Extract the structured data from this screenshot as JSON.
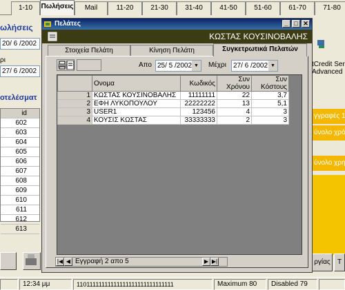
{
  "top_tabs": [
    "1-10",
    "Πωλήσεις",
    "Mail",
    "11-20",
    "21-30",
    "31-40",
    "41-50",
    "51-60",
    "61-70",
    "71-80"
  ],
  "left": {
    "heading": "ωλήσεις",
    "date_from": "20/ 6 /2002",
    "label_to": "ρι",
    "date_to": "27/ 6 /2002",
    "results_heading": "οτελέσματ",
    "id_header": "id",
    "ids": [
      "602",
      "603",
      "604",
      "605",
      "606",
      "607",
      "608",
      "609",
      "610",
      "611",
      "612",
      "613"
    ]
  },
  "right": {
    "server_line1": "tCredit Serve",
    "server_line2": "Advanced",
    "bar1": "γγραφές 1",
    "bar2": "ύνολο χρό",
    "bar3": "ύνολο χρη",
    "button1": "ργίας",
    "button2": "T"
  },
  "dialog": {
    "title": "Πελάτες",
    "customer_name": "ΚΩΣΤΑΣ ΚΟΥΣΙΝΟΒΑΛΗΣ",
    "tabs": [
      "Στοιχεία Πελάτη",
      "Κίνηση Πελάτη",
      "Συγκετρωτικά Πελατών"
    ],
    "from_label": "Απο",
    "from_date": "25/ 5 /2002",
    "to_label": "Μέχρι",
    "to_date": "27/ 6 /2002",
    "columns": [
      "",
      "Ονομα",
      "Κωδικός",
      "Συν Χρόνου",
      "Συν Κόστους"
    ],
    "rows": [
      [
        "1",
        "ΚΩΣΤΑΣ ΚΟΥΣΙΝΟΒΑΛΗΣ",
        "11111111",
        "22",
        "3,7"
      ],
      [
        "2",
        "ΕΦΗ ΛΥΚΟΠΟΥΛΟΥ",
        "22222222",
        "13",
        "5,1"
      ],
      [
        "3",
        "USER1",
        "123456",
        "4",
        "3"
      ],
      [
        "4",
        "ΚΟΥΣΙΣ ΚΩΣΤΑΣ",
        "33333333",
        "2",
        "3"
      ]
    ],
    "nav_text": "Εγγραφή 2 απο 5"
  },
  "status": {
    "time": "12:34 μμ",
    "bits": "11011111111111111111111111111111",
    "max": "Maximum 80",
    "disabled": "Disabled 79"
  }
}
